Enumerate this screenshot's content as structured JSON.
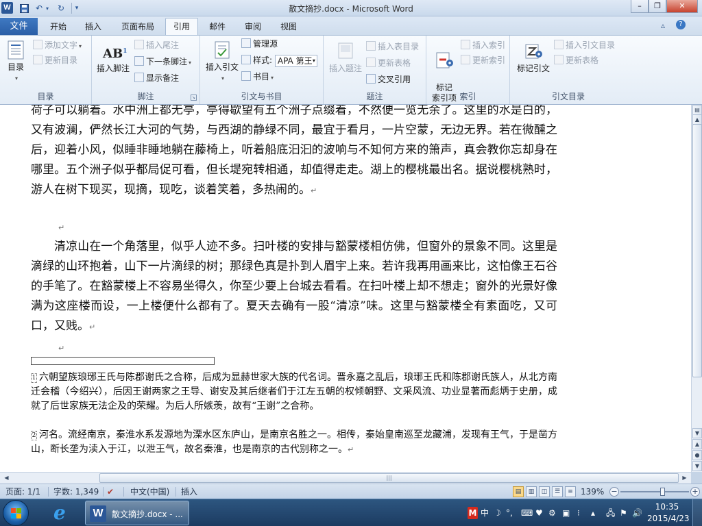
{
  "window": {
    "title": "散文摘抄.docx - Microsoft Word",
    "app_icon": "W"
  },
  "tabs": {
    "file": "文件",
    "items": [
      "开始",
      "插入",
      "页面布局",
      "引用",
      "邮件",
      "审阅",
      "视图"
    ],
    "active": "引用"
  },
  "ribbon": {
    "toc": {
      "toc_label": "目录",
      "add_text": "添加文字",
      "update_toc": "更新目录",
      "group_label": "目录"
    },
    "footnotes": {
      "insert_footnote": "插入脚注",
      "insert_endnote": "插入尾注",
      "next_footnote": "下一条脚注",
      "show_notes": "显示备注",
      "group_label": "脚注"
    },
    "citations": {
      "insert_citation": "插入引文",
      "manage_sources": "管理源",
      "style_label": "样式:",
      "style_value": "APA 第王",
      "bibliography": "书目",
      "group_label": "引文与书目"
    },
    "captions": {
      "insert_caption": "插入题注",
      "insert_table_of_figures": "插入表目录",
      "update_table": "更新表格",
      "cross_reference": "交叉引用",
      "group_label": "题注"
    },
    "index": {
      "mark_entry": "标记\n索引项",
      "insert_index": "插入索引",
      "update_index": "更新索引",
      "group_label": "索引"
    },
    "toa": {
      "mark_citation": "标记引文",
      "insert_toa": "插入引文目录",
      "update_table": "更新表格",
      "group_label": "引文目录"
    }
  },
  "document": {
    "para1": "荷子可以躺着。水中洲上都无亭，亭得歇望有五个洲子点缀着，不然便一览无余了。这里的水是白的，又有波澜，俨然长江大河的气势，与西湖的静绿不同，最宜于看月，一片空蒙，无边无界。若在微醺之后，迎着小风，似睡非睡地躺在藤椅上，听着船底汩汩的波响与不知何方来的箫声，真会教你忘却身在哪里。五个洲子似乎都局促可看，但长堤宛转相通，却值得走走。湖上的樱桃最出名。据说樱桃熟时，游人在树下现买，现摘，现吃，谈着笑着，多热闹的。",
    "para2": "清凉山在一个角落里，似乎人迹不多。扫叶楼的安排与豁蒙楼相仿佛，但窗外的景象不同。这里是滴绿的山环抱着，山下一片滴绿的树；那绿色真是扑到人眉宇上来。若许我再用画来比，这怕像王石谷的手笔了。在豁蒙楼上不容易坐得久，你至少要上台城去看看。在扫叶楼上却不想走；窗外的光景好像满为这座楼而设，一上楼便什么都有了。夏天去确有一股“清凉”味。这里与豁蒙楼全有素面吃，又可口，又贱。",
    "para_mark": "↵",
    "footnote1": "六朝望族琅琊王氏与陈郡谢氏之合称，后成为显赫世家大族的代名词。晋永嘉之乱后，琅琊王氏和陈郡谢氏族人，从北方南迁会稽（今绍兴），后因王谢两家之王导、谢安及其后继者们于江左五朝的权倾朝野、文采风流、功业显著而彪炳于史册，成就了后世家族无法企及的荣耀。为后人所嫉羡，故有“王谢”之合称。",
    "footnote2": "河名。流经南京，秦淮水系发源地为溧水区东庐山，是南京名胜之一。相传，秦始皇南巡至龙藏浦，发现有王气，于是凿方山，断长垄为渎入于江，以泄王气，故名秦淮，也是南京的古代别称之一。"
  },
  "statusbar": {
    "page": "页面: 1/1",
    "words": "字数: 1,349",
    "language": "中文(中国)",
    "mode": "插入",
    "zoom": "139%",
    "zoom_fraction": 0.62
  },
  "taskbar": {
    "word_task": "散文摘抄.docx - ...",
    "ime": "中",
    "time": "10:35",
    "date": "2015/4/23"
  },
  "colors": {
    "file_tab": "#2a5ea6",
    "taskbar": "#1c3b61",
    "word_icon": "#2b5797"
  }
}
